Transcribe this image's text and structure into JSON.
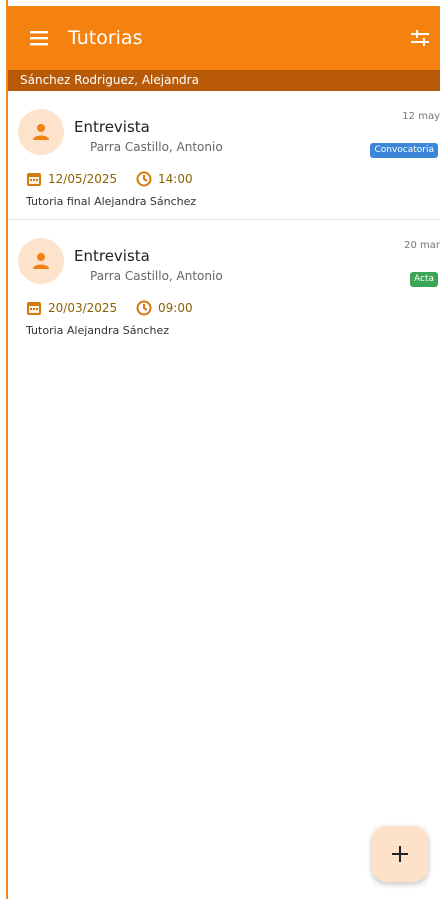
{
  "app": {
    "title": "Tutorias",
    "student": "Sánchez Rodriguez, Alejandra"
  },
  "colors": {
    "primary": "#f5820f",
    "primary_dark": "#b85a08",
    "accent_bg": "#fde3cc",
    "date_text": "#8a6300",
    "badge_blue": "#3b86d8",
    "badge_green": "#3aa655"
  },
  "icons": {
    "menu": "menu-icon",
    "filter": "filter-icon",
    "person": "person-icon",
    "calendar": "calendar-icon",
    "clock": "clock-icon",
    "add": "add-icon"
  },
  "tutorias": [
    {
      "type": "Entrevista",
      "teacher": "Parra Castillo, Antonio",
      "short_date": "12 may",
      "status": "Convocatoria",
      "date": "12/05/2025",
      "time": "14:00",
      "description": "Tutoria final Alejandra Sánchez"
    },
    {
      "type": "Entrevista",
      "teacher": "Parra Castillo, Antonio",
      "short_date": "20 mar",
      "status": "Acta",
      "date": "20/03/2025",
      "time": "09:00",
      "description": "Tutoria Alejandra Sánchez"
    }
  ],
  "fab": {
    "label": "+"
  }
}
